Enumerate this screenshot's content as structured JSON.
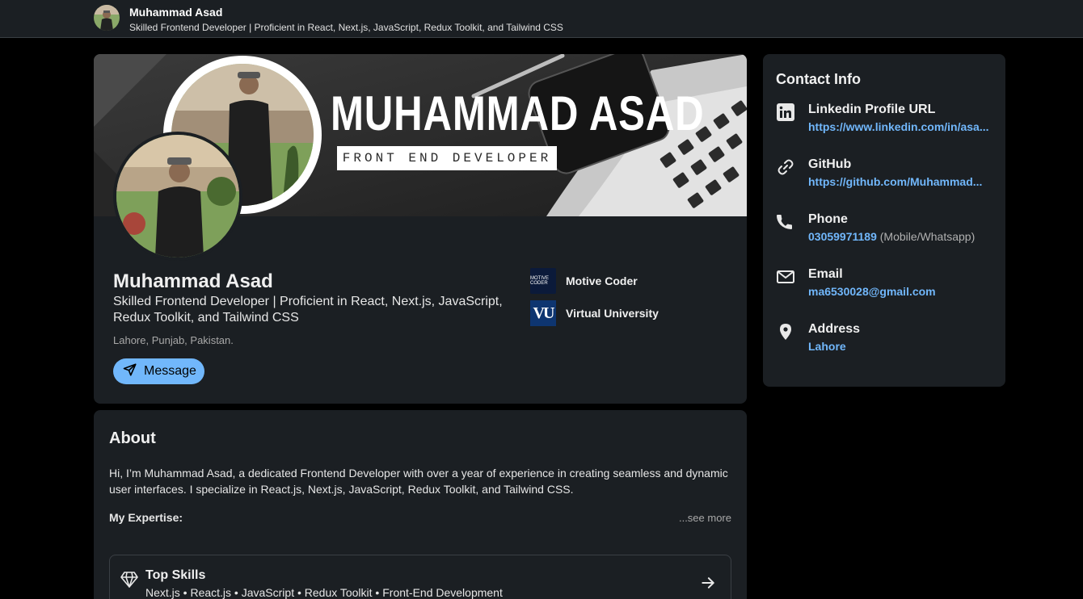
{
  "header": {
    "name": "Muhammad Asad",
    "headline": "Skilled Frontend Developer | Proficient in React, Next.js, JavaScript, Redux Toolkit, and Tailwind CSS"
  },
  "banner": {
    "title": "MUHAMMAD ASAD",
    "subtitle": "FRONT END DEVELOPER"
  },
  "profile": {
    "name": "Muhammad Asad",
    "headline": "Skilled Frontend Developer | Proficient in React, Next.js, JavaScript, Redux Toolkit, and Tailwind CSS",
    "location": "Lahore, Punjab, Pakistan.",
    "message_label": "Message",
    "organizations": [
      {
        "name": "Motive Coder",
        "logo_text": "MOTIVE CODER"
      },
      {
        "name": "Virtual University",
        "logo_text": "VU"
      }
    ]
  },
  "contact": {
    "title": "Contact Info",
    "items": [
      {
        "icon": "linkedin-icon",
        "label": "Linkedin Profile URL",
        "value": "https://www.linkedin.com/in/asa...",
        "note": ""
      },
      {
        "icon": "link-icon",
        "label": "GitHub",
        "value": "https://github.com/Muhammad...",
        "note": ""
      },
      {
        "icon": "phone-icon",
        "label": "Phone",
        "value": "03059971189",
        "note": " (Mobile/Whatsapp)"
      },
      {
        "icon": "email-icon",
        "label": "Email",
        "value": "ma6530028@gmail.com",
        "note": ""
      },
      {
        "icon": "location-pin-icon",
        "label": "Address",
        "value": "Lahore",
        "note": ""
      }
    ]
  },
  "about": {
    "title": "About",
    "text": "Hi, I’m Muhammad Asad, a dedicated Frontend Developer with over a year of experience in creating seamless and dynamic user interfaces. I specialize in React.js, Next.js, JavaScript, Redux Toolkit, and Tailwind CSS.",
    "expertise_label": "My Expertise:",
    "see_more": "...see more",
    "top_skills": {
      "title": "Top Skills",
      "list": "Next.js • React.js • JavaScript • Redux Toolkit • Front-End Development"
    }
  },
  "colors": {
    "background": "#000000",
    "card": "#1b1f23",
    "accent": "#71b7fb"
  }
}
